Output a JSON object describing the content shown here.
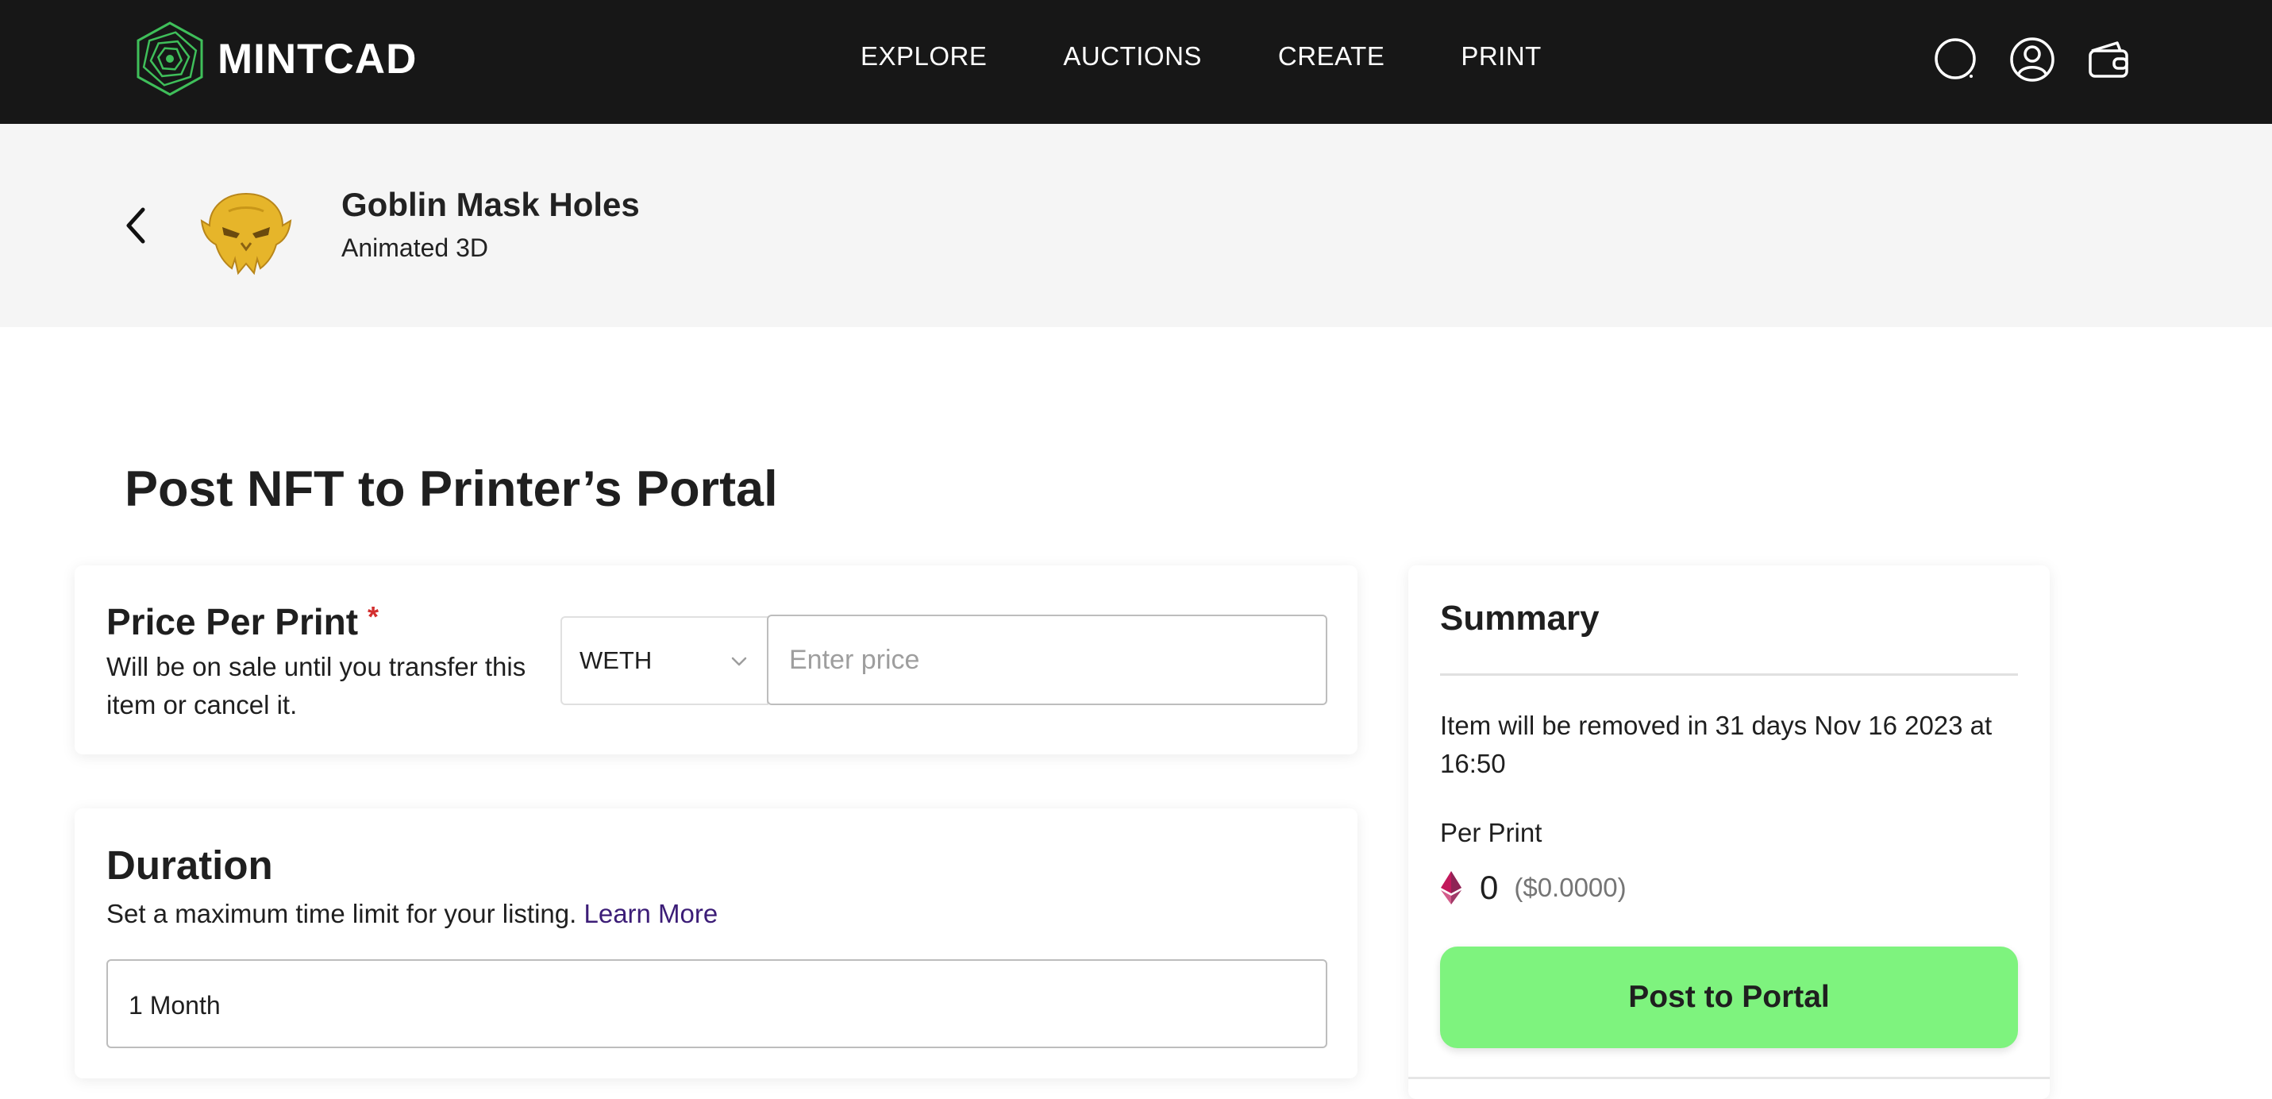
{
  "nav": {
    "brand": "MINTCAD",
    "links": [
      "EXPLORE",
      "AUCTIONS",
      "CREATE",
      "PRINT"
    ],
    "icons": [
      "search-icon",
      "account-icon",
      "wallet-icon"
    ]
  },
  "item": {
    "title": "Goblin Mask Holes",
    "subtitle": "Animated 3D"
  },
  "page": {
    "title": "Post NFT to Printer’s Portal"
  },
  "price": {
    "title": "Price Per Print",
    "required_mark": "*",
    "description": "Will be on sale until you transfer this item or cancel it.",
    "currency": "WETH",
    "placeholder": "Enter price"
  },
  "duration": {
    "title": "Duration",
    "description": "Set a maximum time limit for your listing.",
    "learn_more": "Learn More",
    "value": "1 Month"
  },
  "summary": {
    "title": "Summary",
    "note": "Item will be removed in 31 days Nov 16 2023 at 16:50",
    "per_print_label": "Per Print",
    "amount": "0",
    "usd": "($0.0000)",
    "button_label": "Post to Portal"
  },
  "colors": {
    "nav_bg": "#171717",
    "brand_green": "#3fbf5a",
    "button_green": "#7ef37e",
    "link_purple": "#3c1d77",
    "required_red": "#d32f2f"
  }
}
